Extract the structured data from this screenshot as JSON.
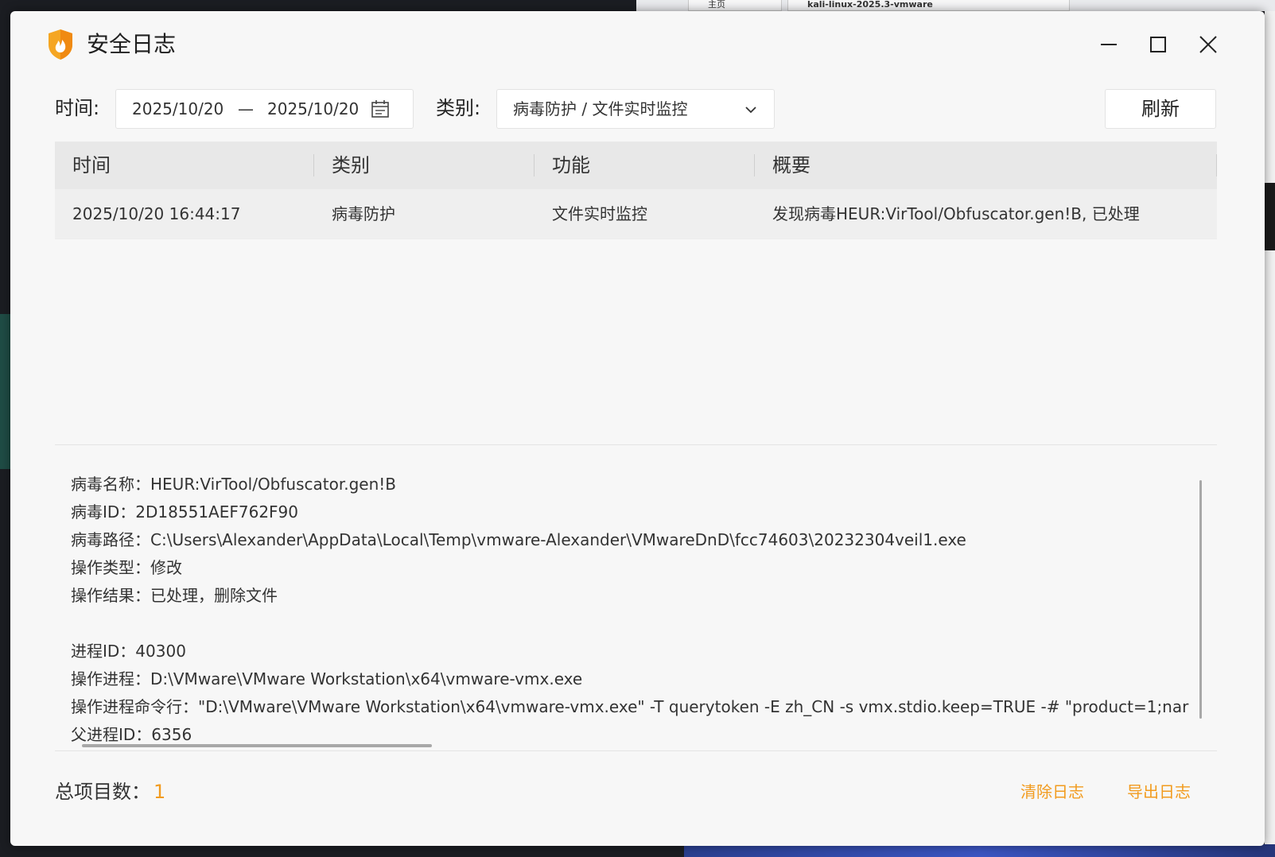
{
  "background": {
    "tabs": [
      {
        "label": "主页"
      },
      {
        "label": "kali-linux-2025.3-vmware"
      }
    ]
  },
  "window": {
    "title": "安全日志",
    "controls": [
      "minimize-icon",
      "maximize-icon",
      "close-icon"
    ]
  },
  "filters": {
    "time_label": "时间:",
    "date_start": "2025/10/20",
    "date_sep": "—",
    "date_end": "2025/10/20",
    "category_label": "类别:",
    "category_value": "病毒防护 / 文件实时监控",
    "refresh_label": "刷新"
  },
  "table": {
    "headers": [
      "时间",
      "类别",
      "功能",
      "概要"
    ],
    "rows": [
      {
        "time": "2025/10/20 16:44:17",
        "category": "病毒防护",
        "function": "文件实时监控",
        "summary": "发现病毒HEUR:VirTool/Obfuscator.gen!B, 已处理"
      }
    ]
  },
  "details": {
    "lines": [
      "病毒名称：HEUR:VirTool/Obfuscator.gen!B",
      "病毒ID：2D18551AEF762F90",
      "病毒路径：C:\\Users\\Alexander\\AppData\\Local\\Temp\\vmware-Alexander\\VMwareDnD\\fcc74603\\20232304veil1.exe",
      "操作类型：修改",
      "操作结果：已处理，删除文件",
      "",
      "进程ID：40300",
      "操作进程：D:\\VMware\\VMware Workstation\\x64\\vmware-vmx.exe",
      "操作进程命令行：\"D:\\VMware\\VMware Workstation\\x64\\vmware-vmx.exe\" -T querytoken -E zh_CN -s vmx.stdio.keep=TRUE -# \"product=1;nar",
      "父进程ID：6356"
    ]
  },
  "footer": {
    "total_label": "总项目数：",
    "total_value": "1",
    "clear_label": "清除日志",
    "export_label": "导出日志"
  },
  "colors": {
    "accent": "#f29b1e",
    "window_bg": "#f7f7f7",
    "header_bg": "#e8e8e8"
  }
}
